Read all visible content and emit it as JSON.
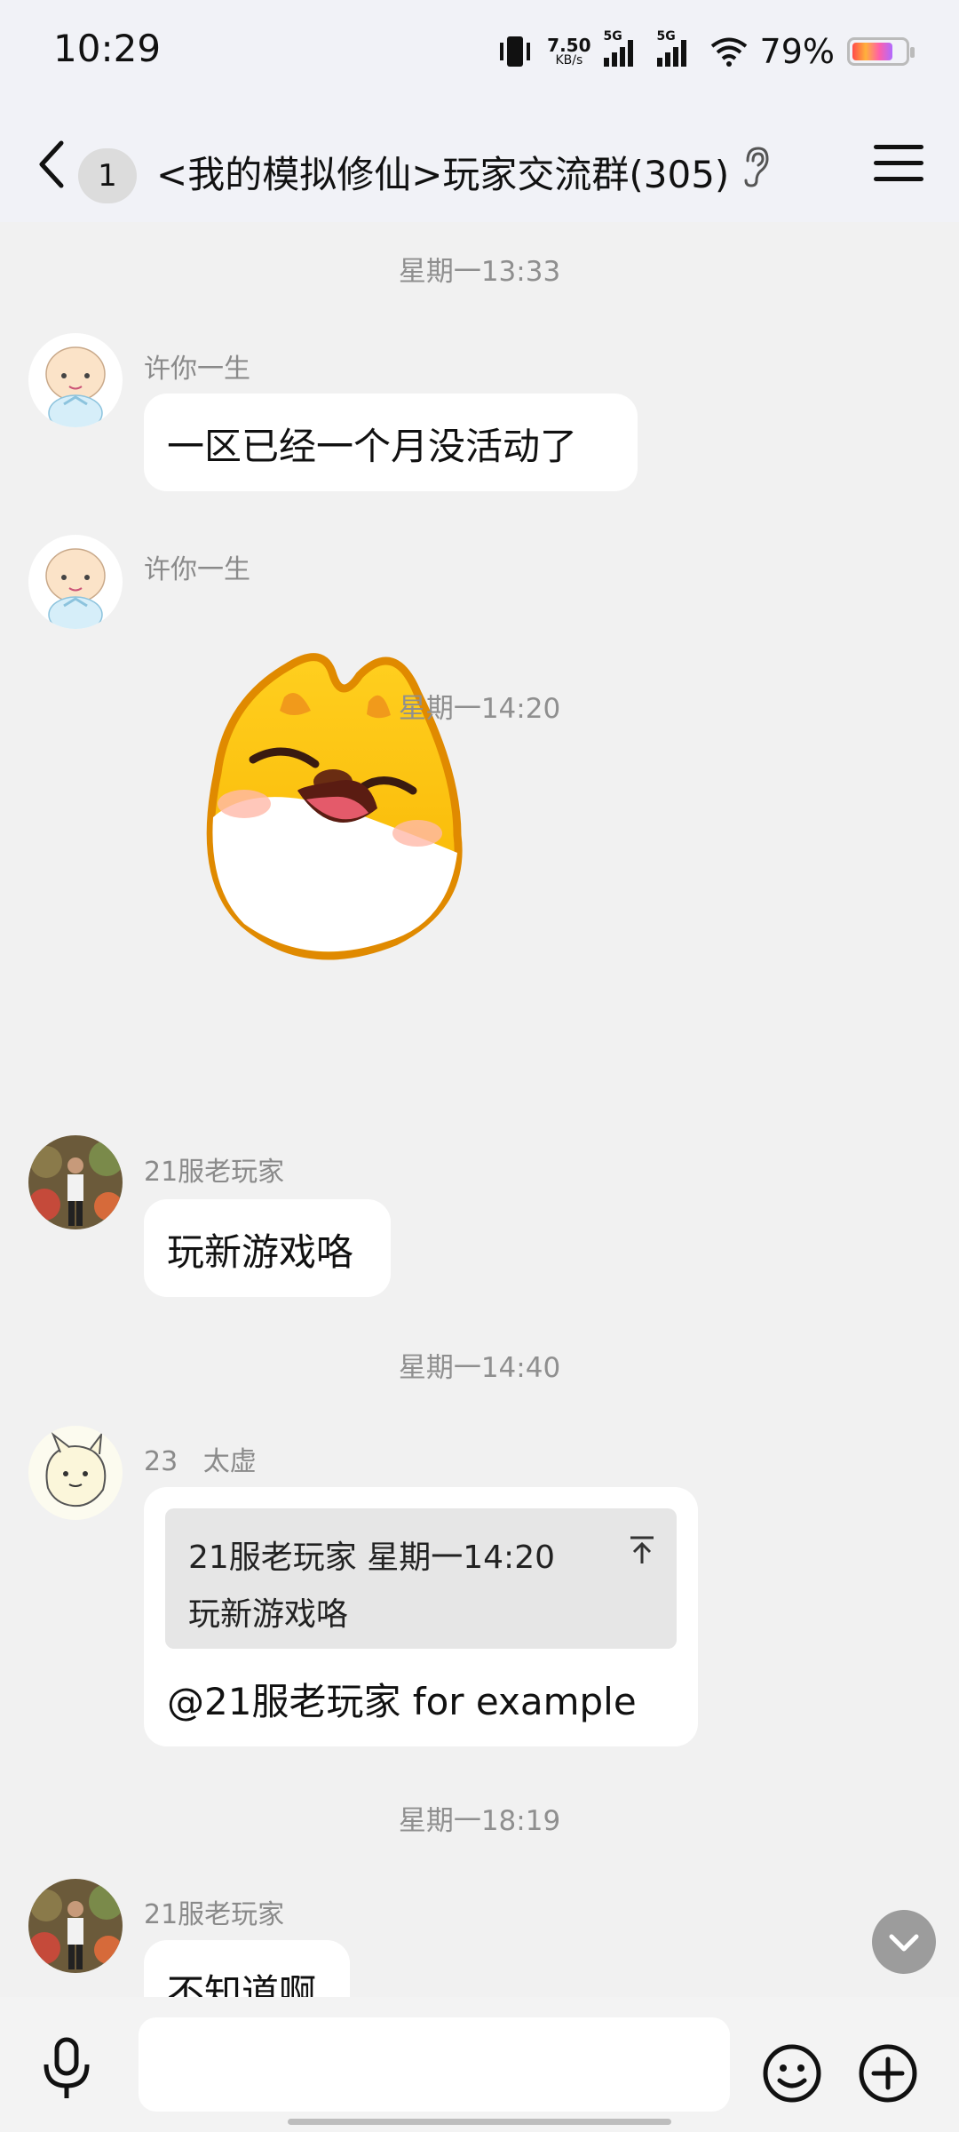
{
  "status_bar": {
    "time": "10:29",
    "net_speed_value": "7.50",
    "net_speed_unit": "KB/s",
    "sim1": "5G",
    "sim2": "5G",
    "battery": "79%"
  },
  "header": {
    "back_count": "1",
    "title": "<我的模拟修仙>玩家交流群(305)"
  },
  "messages": [
    {
      "timestamp": "星期一13:33"
    },
    {
      "sender": "许你一生",
      "text": "一区已经一个月没活动了"
    },
    {
      "sender": "许你一生",
      "sticker": "yellow-fox-sticker"
    },
    {
      "timestamp": "星期一14:20"
    },
    {
      "sender": "21服老玩家",
      "text": "玩新游戏咯"
    },
    {
      "timestamp": "星期一14:40"
    },
    {
      "sender": "23   太虚",
      "quote_header": "21服老玩家  星期一14:20",
      "quote_text": "玩新游戏咯",
      "text": "@21服老玩家 for example"
    },
    {
      "timestamp": "星期一18:19"
    },
    {
      "sender": "21服老玩家",
      "text": "不知道啊"
    }
  ],
  "input": {
    "placeholder": ""
  },
  "icons": [
    "back-icon",
    "ear-icon",
    "menu-icon",
    "mic-icon",
    "emoji-icon",
    "plus-icon",
    "scroll-down-icon"
  ]
}
